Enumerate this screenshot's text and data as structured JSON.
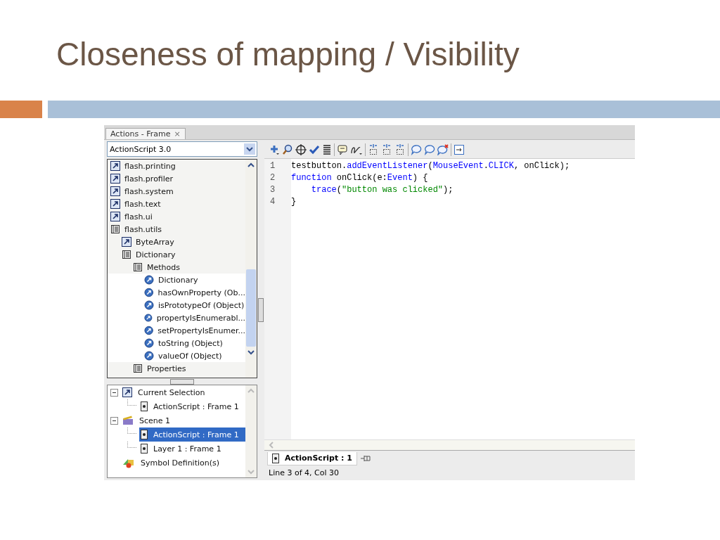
{
  "slide": {
    "title": "Closeness of mapping / Visibility"
  },
  "panel_tab": {
    "label": "Actions - Frame",
    "close": "×"
  },
  "language_dropdown": {
    "value": "ActionScript 3.0"
  },
  "library_tree": [
    {
      "label": "flash.printing",
      "kind": "package"
    },
    {
      "label": "flash.profiler",
      "kind": "package"
    },
    {
      "label": "flash.system",
      "kind": "package"
    },
    {
      "label": "flash.text",
      "kind": "package"
    },
    {
      "label": "flash.ui",
      "kind": "package"
    },
    {
      "label": "flash.utils",
      "kind": "book",
      "children": [
        {
          "label": "ByteArray",
          "kind": "package"
        },
        {
          "label": "Dictionary",
          "kind": "book",
          "children": [
            {
              "label": "Methods",
              "kind": "book",
              "children": [
                {
                  "label": "Dictionary",
                  "kind": "method"
                },
                {
                  "label": "hasOwnProperty (Ob...",
                  "kind": "method"
                },
                {
                  "label": "isPrototypeOf (Object)",
                  "kind": "method"
                },
                {
                  "label": "propertyIsEnumerabl...",
                  "kind": "method"
                },
                {
                  "label": "setPropertyIsEnumer...",
                  "kind": "method"
                },
                {
                  "label": "toString (Object)",
                  "kind": "method"
                },
                {
                  "label": "valueOf (Object)",
                  "kind": "method"
                }
              ]
            },
            {
              "label": "Properties",
              "kind": "book"
            }
          ]
        }
      ]
    }
  ],
  "script_tree": [
    {
      "label": "Current Selection",
      "kind": "selection",
      "expanded": true,
      "selected": false,
      "children": [
        {
          "label": "ActionScript : Frame 1",
          "kind": "frame",
          "selected": false
        }
      ]
    },
    {
      "label": "Scene 1",
      "kind": "scene",
      "expanded": true,
      "selected": false,
      "children": [
        {
          "label": "ActionScript : Frame 1",
          "kind": "frame",
          "selected": true
        },
        {
          "label": "Layer 1 : Frame 1",
          "kind": "frame",
          "selected": false
        }
      ]
    },
    {
      "label": "Symbol Definition(s)",
      "kind": "symbols",
      "selected": false
    }
  ],
  "code_lines": [
    {
      "number": "1",
      "tokens": [
        {
          "text": "testbutton.",
          "kind": "plain"
        },
        {
          "text": "addEventListener",
          "kind": "keyword"
        },
        {
          "text": "(",
          "kind": "plain"
        },
        {
          "text": "MouseEvent",
          "kind": "keyword"
        },
        {
          "text": ".",
          "kind": "plain"
        },
        {
          "text": "CLICK",
          "kind": "keyword"
        },
        {
          "text": ", onClick);",
          "kind": "plain"
        }
      ]
    },
    {
      "number": "2",
      "tokens": [
        {
          "text": "function",
          "kind": "keyword"
        },
        {
          "text": " onClick(e:",
          "kind": "plain"
        },
        {
          "text": "Event",
          "kind": "keyword"
        },
        {
          "text": ") {",
          "kind": "plain"
        }
      ]
    },
    {
      "number": "3",
      "tokens": [
        {
          "text": "    trace",
          "kind": "keyword"
        },
        {
          "text": "(",
          "kind": "plain"
        },
        {
          "text": "\"button was clicked\"",
          "kind": "string"
        },
        {
          "text": ");",
          "kind": "plain"
        }
      ]
    },
    {
      "number": "4",
      "tokens": [
        {
          "text": "}",
          "kind": "plain"
        }
      ]
    }
  ],
  "script_tab": {
    "label": "ActionScript : 1"
  },
  "status_bar": {
    "text": "Line 3 of 4, Col 30"
  }
}
